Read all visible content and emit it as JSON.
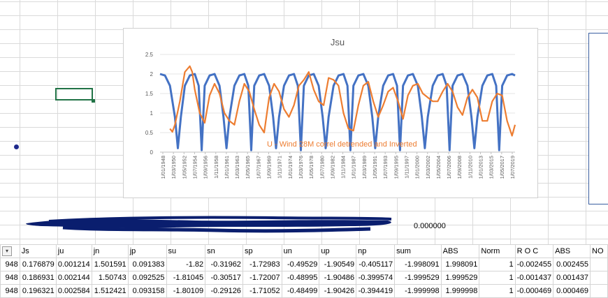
{
  "sheet": {
    "selected_cell_value": "0.000000",
    "headers": [
      "Js",
      "ju",
      "jn",
      "jp",
      "su",
      "sn",
      "sp",
      "un",
      "up",
      "np",
      "sum",
      "ABS",
      "Norm",
      "R O C",
      "ABS",
      "NO"
    ],
    "rows": [
      {
        "first": "948",
        "cells": [
          "0.176879",
          "0.001214",
          "1.501591",
          "0.091383",
          "-1.82",
          "-0.31962",
          "-1.72983",
          "-0.49529",
          "-1.90549",
          "-0.405117",
          "-1.998091",
          "1.998091",
          "1",
          "-0.002455",
          "0.002455",
          ""
        ]
      },
      {
        "first": "948",
        "cells": [
          "0.186931",
          "0.002144",
          "1.50743",
          "0.092525",
          "-1.81045",
          "-0.30517",
          "-1.72007",
          "-0.48995",
          "-1.90486",
          "-0.399574",
          "-1.999529",
          "1.999529",
          "1",
          "-0.001437",
          "0.001437",
          ""
        ]
      },
      {
        "first": "948",
        "cells": [
          "0.196321",
          "0.002584",
          "1.512421",
          "0.093158",
          "-1.80109",
          "-0.29126",
          "-1.71052",
          "-0.48499",
          "-1.90426",
          "-0.394419",
          "-1.999998",
          "1.999998",
          "1",
          "-0.000469",
          "0.000469",
          ""
        ]
      }
    ]
  },
  "chart_data": {
    "type": "line",
    "title": "Jsu",
    "annotation": "U - Wind 28M correl detrended and Inverted",
    "ylim": [
      0,
      2.5
    ],
    "yticks": [
      "0",
      "0.5",
      "1",
      "1.5",
      "2",
      "2.5"
    ],
    "xticks": [
      "1/01/1948",
      "1/03/1950",
      "1/05/1952",
      "1/07/1954",
      "1/09/1956",
      "1/11/1958",
      "1/01/1961",
      "1/03/1963",
      "1/05/1965",
      "1/07/1967",
      "1/09/1969",
      "1/11/1971",
      "1/01/1974",
      "1/03/1976",
      "1/05/1978",
      "1/07/1980",
      "1/09/1982",
      "1/11/1984",
      "1/01/1987",
      "1/03/1989",
      "1/05/1991",
      "1/07/1993",
      "1/09/1995",
      "1/11/1997",
      "1/01/2000",
      "1/03/2002",
      "1/05/2004",
      "1/07/2006",
      "1/09/2008",
      "1/11/2010",
      "1/01/2013",
      "1/03/2015",
      "1/05/2017",
      "1/07/2019"
    ],
    "x_start": 1948.0,
    "x_end": 2019.6,
    "series": [
      {
        "name": "",
        "color": "#4472c4",
        "x": [
          1948,
          1949,
          1950,
          1951,
          1951.6,
          1952.2,
          1953,
          1954,
          1955,
          1955.8,
          1956.4,
          1957,
          1958,
          1959,
          1960,
          1960.8,
          1961.4,
          1962,
          1963,
          1964,
          1965,
          1965.8,
          1966.4,
          1967,
          1968,
          1969,
          1970,
          1970.8,
          1971.4,
          1972,
          1973,
          1974,
          1975,
          1975.8,
          1976.4,
          1977,
          1978,
          1979,
          1980,
          1980.8,
          1981.4,
          1982,
          1983,
          1984,
          1985,
          1985.8,
          1986.4,
          1987,
          1988,
          1989,
          1990,
          1990.8,
          1991.4,
          1992,
          1993,
          1994,
          1995,
          1995.8,
          1996.4,
          1997,
          1998,
          1999,
          2000,
          2000.8,
          2001.4,
          2002,
          2003,
          2004,
          2005,
          2005.8,
          2006.4,
          2007,
          2008,
          2009,
          2010,
          2010.8,
          2011.4,
          2012,
          2013,
          2014,
          2015,
          2015.8,
          2016.4,
          2017,
          2018,
          2019,
          2019.6
        ],
        "y": [
          2.0,
          1.96,
          1.7,
          0.9,
          0.1,
          0.9,
          1.7,
          1.96,
          2.0,
          1.7,
          0.05,
          1.7,
          1.96,
          2.0,
          1.7,
          0.9,
          0.1,
          0.9,
          1.7,
          1.96,
          2.0,
          1.7,
          0.05,
          1.7,
          1.96,
          2.0,
          1.7,
          0.9,
          0.1,
          0.9,
          1.7,
          1.96,
          2.0,
          1.7,
          0.05,
          1.7,
          1.96,
          2.0,
          1.7,
          0.9,
          0.1,
          0.9,
          1.7,
          1.96,
          2.0,
          1.7,
          0.05,
          1.7,
          1.96,
          2.0,
          1.7,
          0.9,
          0.1,
          0.9,
          1.7,
          1.96,
          2.0,
          1.7,
          0.05,
          1.7,
          1.96,
          2.0,
          1.7,
          0.9,
          0.1,
          0.9,
          1.7,
          1.96,
          2.0,
          1.7,
          0.05,
          1.7,
          1.96,
          2.0,
          1.7,
          0.9,
          0.1,
          0.9,
          1.7,
          1.96,
          2.0,
          1.7,
          0.05,
          1.7,
          1.96,
          2.0,
          1.96
        ]
      },
      {
        "name": "U - Wind 28M correl detrended and Inverted",
        "color": "#ed7d31",
        "x": [
          1950,
          1950.5,
          1951,
          1952,
          1953,
          1954,
          1954.5,
          1955,
          1956,
          1957,
          1958,
          1959,
          1960,
          1961,
          1962,
          1963,
          1964,
          1965,
          1966,
          1967,
          1968,
          1969,
          1970,
          1971,
          1972,
          1973,
          1974,
          1975,
          1976,
          1977,
          1978,
          1979,
          1980,
          1981,
          1982,
          1983,
          1984,
          1985,
          1986,
          1987,
          1988,
          1989,
          1990,
          1991,
          1992,
          1993,
          1994,
          1995,
          1996,
          1997,
          1998,
          1999,
          2000,
          2001,
          2002,
          2003,
          2004,
          2005,
          2006,
          2007,
          2008,
          2009,
          2010,
          2011,
          2012,
          2013,
          2014,
          2015,
          2016,
          2017,
          2018,
          2019,
          2019.6
        ],
        "y": [
          0.6,
          0.52,
          0.7,
          1.3,
          2.05,
          2.2,
          2.05,
          1.6,
          1.0,
          0.75,
          1.45,
          1.75,
          1.5,
          1.0,
          0.8,
          0.7,
          1.3,
          1.75,
          1.55,
          1.1,
          0.7,
          0.5,
          1.4,
          1.75,
          1.55,
          1.1,
          0.9,
          1.2,
          1.7,
          1.85,
          2.05,
          1.6,
          1.3,
          1.2,
          1.9,
          1.85,
          1.7,
          1.0,
          0.6,
          0.55,
          1.2,
          1.7,
          1.8,
          1.3,
          0.9,
          1.2,
          1.55,
          1.65,
          1.3,
          0.85,
          1.45,
          1.7,
          1.75,
          1.5,
          1.4,
          1.3,
          1.3,
          1.55,
          1.75,
          1.55,
          1.15,
          0.95,
          1.4,
          1.6,
          1.4,
          0.8,
          0.8,
          1.3,
          1.5,
          1.45,
          0.8,
          0.42,
          0.7
        ]
      }
    ]
  }
}
